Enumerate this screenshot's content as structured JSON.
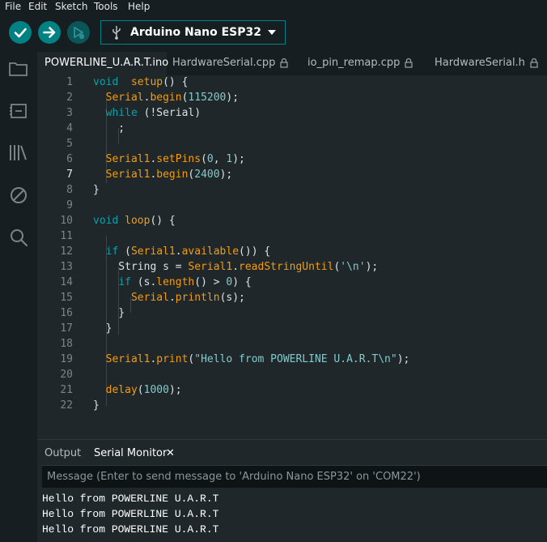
{
  "menu": [
    "File",
    "Edit",
    "Sketch",
    "Tools",
    "Help"
  ],
  "toolbar": {
    "board_name": "Arduino Nano ESP32",
    "verify_icon": "check-icon",
    "upload_icon": "arrow-right-icon",
    "debug_icon": "debug-icon",
    "accent_color": "#008184"
  },
  "sidebar_icons": [
    "folder-icon",
    "board-icon",
    "library-icon",
    "debug-block-icon",
    "search-icon"
  ],
  "tabs": [
    {
      "label": "POWERLINE_U.A.R.T.ino",
      "locked": false
    },
    {
      "label": "HardwareSerial.cpp",
      "locked": true
    },
    {
      "label": "io_pin_remap.cpp",
      "locked": true
    },
    {
      "label": "HardwareSerial.h",
      "locked": true
    }
  ],
  "code": {
    "line_numbers": [
      "1",
      "2",
      "3",
      "4",
      "5",
      "6",
      "7",
      "8",
      "9",
      "10",
      "11",
      "12",
      "13",
      "14",
      "15",
      "16",
      "17",
      "18",
      "19",
      "20",
      "21",
      "22"
    ],
    "current_line": "7",
    "lines": [
      [
        [
          "kw",
          "void"
        ],
        [
          "",
          "  "
        ],
        [
          "fn",
          "setup"
        ],
        [
          "",
          "() {"
        ]
      ],
      [
        [
          "",
          "  "
        ],
        [
          "fn",
          "Serial"
        ],
        [
          "",
          "."
        ],
        [
          "fn",
          "begin"
        ],
        [
          "",
          "("
        ],
        [
          "num",
          "115200"
        ],
        [
          "",
          ");"
        ]
      ],
      [
        [
          "",
          "  "
        ],
        [
          "kw",
          "while"
        ],
        [
          "",
          " (!Serial)"
        ]
      ],
      [
        [
          "",
          "    ;"
        ]
      ],
      [],
      [
        [
          "",
          "  "
        ],
        [
          "fn",
          "Serial1"
        ],
        [
          "",
          "."
        ],
        [
          "fn",
          "setPins"
        ],
        [
          "",
          "("
        ],
        [
          "num",
          "0"
        ],
        [
          "",
          ", "
        ],
        [
          "num",
          "1"
        ],
        [
          "",
          ");"
        ]
      ],
      [
        [
          "",
          "  "
        ],
        [
          "fn",
          "Serial1"
        ],
        [
          "",
          "."
        ],
        [
          "fn",
          "begin"
        ],
        [
          "",
          "("
        ],
        [
          "num",
          "2400"
        ],
        [
          "",
          ");"
        ]
      ],
      [
        [
          "",
          "}"
        ]
      ],
      [],
      [
        [
          "kw",
          "void"
        ],
        [
          "",
          " "
        ],
        [
          "fn",
          "loop"
        ],
        [
          "",
          "() {"
        ]
      ],
      [],
      [
        [
          "",
          "  "
        ],
        [
          "kw",
          "if"
        ],
        [
          "",
          " ("
        ],
        [
          "fn",
          "Serial1"
        ],
        [
          "",
          "."
        ],
        [
          "fn",
          "available"
        ],
        [
          "",
          "()) {"
        ]
      ],
      [
        [
          "",
          "    String s = "
        ],
        [
          "fn",
          "Serial1"
        ],
        [
          "",
          "."
        ],
        [
          "fn",
          "readStringUntil"
        ],
        [
          "",
          "("
        ],
        [
          "str",
          "'\\n'"
        ],
        [
          "",
          ");"
        ]
      ],
      [
        [
          "",
          "    "
        ],
        [
          "kw",
          "if"
        ],
        [
          "",
          " (s."
        ],
        [
          "fn",
          "length"
        ],
        [
          "",
          "() > "
        ],
        [
          "num",
          "0"
        ],
        [
          "",
          ") {"
        ]
      ],
      [
        [
          "",
          "      "
        ],
        [
          "fn",
          "Serial"
        ],
        [
          "",
          "."
        ],
        [
          "fn",
          "println"
        ],
        [
          "",
          "(s);"
        ]
      ],
      [
        [
          "",
          "    }"
        ]
      ],
      [
        [
          "",
          "  }"
        ]
      ],
      [],
      [
        [
          "",
          "  "
        ],
        [
          "fn",
          "Serial1"
        ],
        [
          "",
          "."
        ],
        [
          "fn",
          "print"
        ],
        [
          "",
          "("
        ],
        [
          "str",
          "\"Hello from POWERLINE U.A.R.T\\n\""
        ],
        [
          "",
          ");"
        ]
      ],
      [],
      [
        [
          "",
          "  "
        ],
        [
          "fn",
          "delay"
        ],
        [
          "",
          "("
        ],
        [
          "num",
          "1000"
        ],
        [
          "",
          ");"
        ]
      ],
      [
        [
          "",
          "}"
        ]
      ]
    ]
  },
  "panel": {
    "tab_output": "Output",
    "tab_serial": "Serial Monitor",
    "close_glyph": "✕",
    "message_placeholder": "Message (Enter to send message to 'Arduino Nano ESP32' on 'COM22')",
    "output_lines": [
      "Hello from POWERLINE U.A.R.T",
      "Hello from POWERLINE U.A.R.T",
      "Hello from POWERLINE U.A.R.T"
    ]
  }
}
